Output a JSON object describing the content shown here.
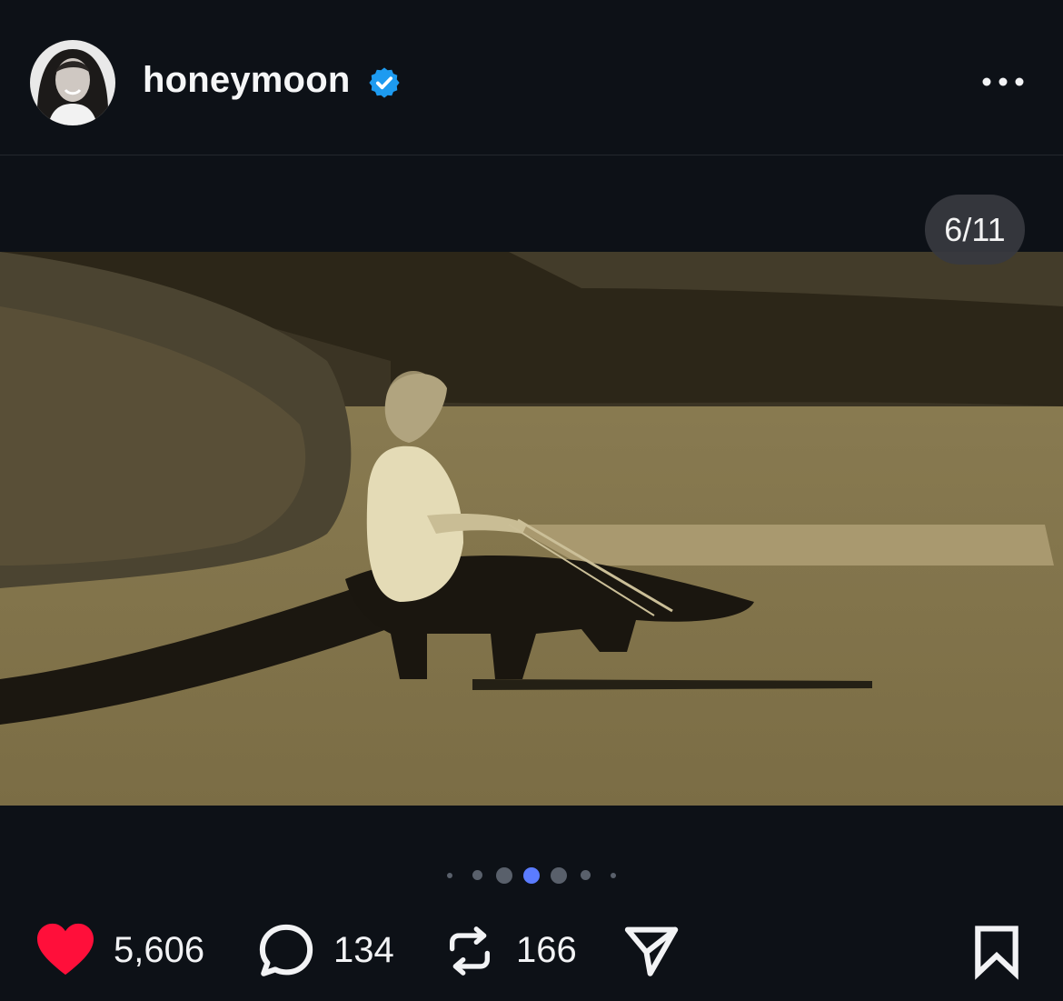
{
  "post": {
    "username": "honeymoon",
    "verified": true,
    "more_icon": "more-horizontal-icon",
    "media": {
      "counter": "6/11",
      "current_index": 6,
      "total": 11,
      "pagination_dots": 7,
      "active_dot": 3
    },
    "actions": {
      "likes": "5,606",
      "comments": "134",
      "reposts": "166",
      "like_icon": "heart-filled-icon",
      "comment_icon": "comment-bubble-icon",
      "repost_icon": "repost-icon",
      "share_icon": "send-icon",
      "save_icon": "bookmark-icon"
    }
  },
  "colors": {
    "background": "#0d1117",
    "verified_badge": "#1d9bf0",
    "like_red": "#ff0f3a",
    "active_dot": "#5b7cff"
  }
}
